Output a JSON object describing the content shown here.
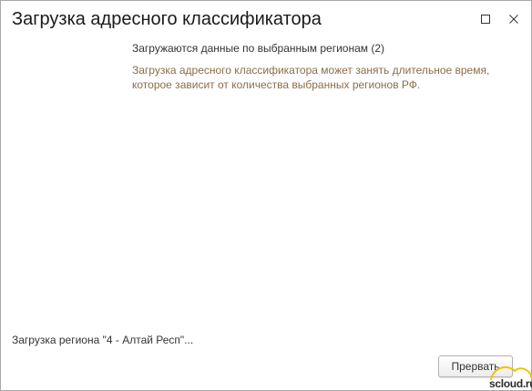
{
  "window": {
    "title": "Загрузка адресного классификатора"
  },
  "message": {
    "title": "Загружаются данные по выбранным регионам (2)",
    "note": "Загрузка адресного классификатора может занять длительное время, которое зависит от количества выбранных регионов РФ."
  },
  "status": {
    "text": "Загрузка региона \"4 - Алтай Респ\"..."
  },
  "buttons": {
    "stop_label": "Прервать"
  },
  "watermark": {
    "text": "scloud.ru"
  },
  "colors": {
    "note_text": "#8c6d4a",
    "watermark_arc": "#f2c200"
  }
}
